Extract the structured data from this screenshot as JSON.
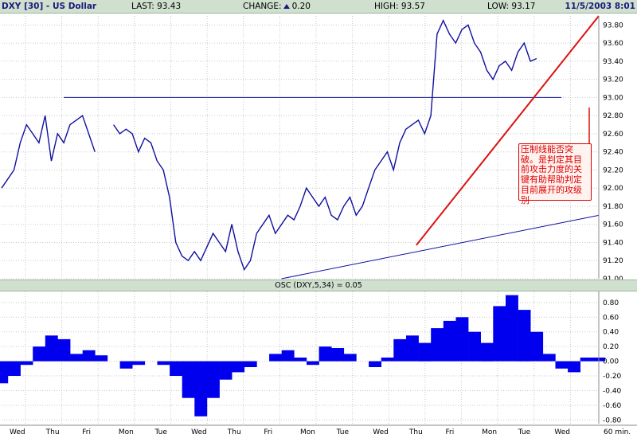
{
  "header": {
    "symbol": "DXY [30] - US Dollar",
    "last_label": "LAST: 93.43",
    "change_label": "CHANGE:",
    "change_value": "0.20",
    "high_label": "HIGH: 93.57",
    "low_label": "LOW: 93.17",
    "date": "11/5/2003 8:01"
  },
  "annotation": {
    "text": "压制线能否突破。是判定其目前攻击力度的关键有助帮助判定目前展开的攻级别"
  },
  "osc_label": "OSC (DXY,5,34) = 0.05",
  "x_axis": {
    "labels": [
      "Wed",
      "Thu",
      "Fri",
      "Mon",
      "Tue",
      "Wed",
      "Thu",
      "Fri",
      "Mon",
      "Tue",
      "Wed",
      "Thu",
      "Fri",
      "Mon",
      "Tue",
      "Wed"
    ],
    "unit": "60 min."
  },
  "colors": {
    "price": "#1010a0",
    "trendline_red": "#dd1111",
    "trendline_blue": "#1010a0",
    "osc_fill": "#0000ee",
    "grid": "#c8c8c8",
    "header_bg": "#cfe0cf"
  },
  "chart_data": [
    {
      "type": "line",
      "title": "DXY [30] - US Dollar",
      "ylim": [
        91.0,
        93.9
      ],
      "yticks": [
        "93.80",
        "93.60",
        "93.40",
        "93.20",
        "93.00",
        "92.80",
        "92.60",
        "92.40",
        "92.20",
        "92.00",
        "91.80",
        "91.60",
        "91.40",
        "91.20",
        "91.00"
      ],
      "x": [
        0,
        3,
        6,
        9,
        12,
        15,
        18,
        21,
        24,
        27,
        30,
        33,
        36,
        39,
        42,
        45,
        48,
        51,
        54,
        57,
        60,
        63,
        66,
        69,
        72,
        75,
        78,
        81,
        84,
        87,
        90,
        93,
        96,
        99,
        102,
        105,
        108,
        111,
        114,
        117,
        120,
        123,
        126,
        129,
        132,
        135,
        138,
        141,
        144,
        147,
        150,
        153,
        156,
        159,
        162,
        165,
        168,
        171,
        174,
        177,
        180,
        183,
        186,
        189,
        192,
        195,
        198,
        201,
        204,
        207,
        210,
        213,
        216,
        219,
        222,
        225,
        228,
        231,
        234,
        237,
        240,
        243,
        246,
        249,
        252,
        255,
        258,
        261,
        264,
        267,
        270,
        273,
        276,
        279,
        282,
        285,
        288
      ],
      "series": [
        {
          "name": "DXY",
          "values": [
            92.0,
            92.1,
            92.2,
            92.5,
            92.7,
            92.6,
            92.5,
            92.8,
            92.3,
            92.6,
            92.5,
            92.7,
            92.75,
            92.8,
            92.6,
            92.4,
            null,
            null,
            92.7,
            92.6,
            92.65,
            92.6,
            92.4,
            92.55,
            92.5,
            92.3,
            92.2,
            91.9,
            91.4,
            91.25,
            91.2,
            91.3,
            91.2,
            91.35,
            91.5,
            91.4,
            91.3,
            91.6,
            91.3,
            91.1,
            91.2,
            91.5,
            91.6,
            91.7,
            91.5,
            91.6,
            91.7,
            91.65,
            91.8,
            92.0,
            91.9,
            91.8,
            91.9,
            91.7,
            91.65,
            91.8,
            91.9,
            91.7,
            91.8,
            92.0,
            92.2,
            92.3,
            92.4,
            92.2,
            92.5,
            92.65,
            92.7,
            92.75,
            92.6,
            92.8,
            93.7,
            93.85,
            93.7,
            93.6,
            93.75,
            93.8,
            93.6,
            93.5,
            93.3,
            93.2,
            93.35,
            93.4,
            93.3,
            93.5,
            93.6,
            93.4,
            93.43,
            null,
            null,
            null,
            null,
            null,
            null,
            null,
            null,
            null,
            null
          ]
        }
      ],
      "trendlines": [
        {
          "name": "horizontal-resistance",
          "from": [
            30,
            93.0
          ],
          "to": [
            270,
            93.0
          ]
        },
        {
          "name": "red-support",
          "from": [
            200,
            91.37
          ],
          "to": [
            288,
            93.9
          ]
        },
        {
          "name": "blue-support",
          "from": [
            135,
            91.0
          ],
          "to": [
            288,
            91.7
          ]
        }
      ]
    },
    {
      "type": "bar",
      "title": "OSC (DXY,5,34) = 0.05",
      "ylim": [
        -0.85,
        0.95
      ],
      "yticks": [
        "0.80",
        "0.60",
        "0.40",
        "0.20",
        "0.00",
        "-0.20",
        "-0.40",
        "-0.60",
        "-0.80"
      ],
      "x": [
        0,
        6,
        12,
        18,
        24,
        30,
        36,
        42,
        48,
        54,
        60,
        66,
        72,
        78,
        84,
        90,
        96,
        102,
        108,
        114,
        120,
        126,
        132,
        138,
        144,
        150,
        156,
        162,
        168,
        174,
        180,
        186,
        192,
        198,
        204,
        210,
        216,
        222,
        228,
        234,
        240,
        246,
        252,
        258,
        264,
        270,
        276,
        282,
        288
      ],
      "values": [
        -0.3,
        -0.2,
        -0.05,
        0.2,
        0.35,
        0.3,
        0.1,
        0.15,
        0.08,
        null,
        -0.1,
        -0.05,
        0.0,
        -0.05,
        -0.2,
        -0.5,
        -0.75,
        -0.5,
        -0.25,
        -0.15,
        -0.08,
        0.0,
        0.1,
        0.15,
        0.05,
        -0.05,
        0.2,
        0.18,
        0.1,
        0.0,
        -0.08,
        0.05,
        0.3,
        0.35,
        0.25,
        0.45,
        0.55,
        0.6,
        0.4,
        0.25,
        0.75,
        0.9,
        0.7,
        0.4,
        0.1,
        -0.1,
        -0.15,
        0.05,
        0.05
      ]
    }
  ]
}
